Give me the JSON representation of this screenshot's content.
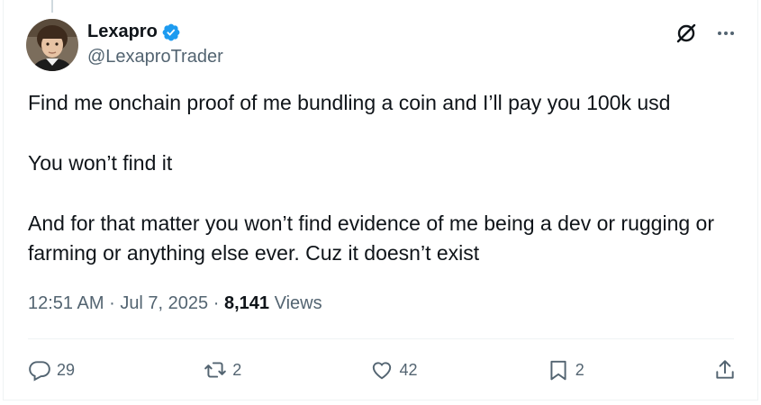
{
  "author": {
    "display_name": "Lexapro",
    "handle": "@LexaproTrader",
    "verified": true,
    "avatar": "profile-photo"
  },
  "tweet": {
    "paragraphs": [
      "Find me onchain proof of me bundling a coin and I’ll pay you 100k usd",
      "You won’t find it",
      "And for that matter you won’t find evidence of me being a dev or rugging or farming or anything else ever. Cuz it doesn’t exist"
    ]
  },
  "meta": {
    "time": "12:51 AM",
    "separator": "·",
    "date": "Jul 7, 2025",
    "views_count": "8,141",
    "views_label": "Views"
  },
  "actions": {
    "replies": "29",
    "reposts": "2",
    "likes": "42",
    "bookmarks": "2"
  },
  "icons": {
    "top": [
      "grok-slash-icon",
      "more-icon"
    ],
    "bar": [
      "reply-icon",
      "repost-icon",
      "like-icon",
      "bookmark-icon",
      "share-icon"
    ]
  },
  "colors": {
    "verified": "#1d9bf0",
    "text": "#0f1419",
    "secondary": "#536471",
    "border": "#eff3f4"
  }
}
